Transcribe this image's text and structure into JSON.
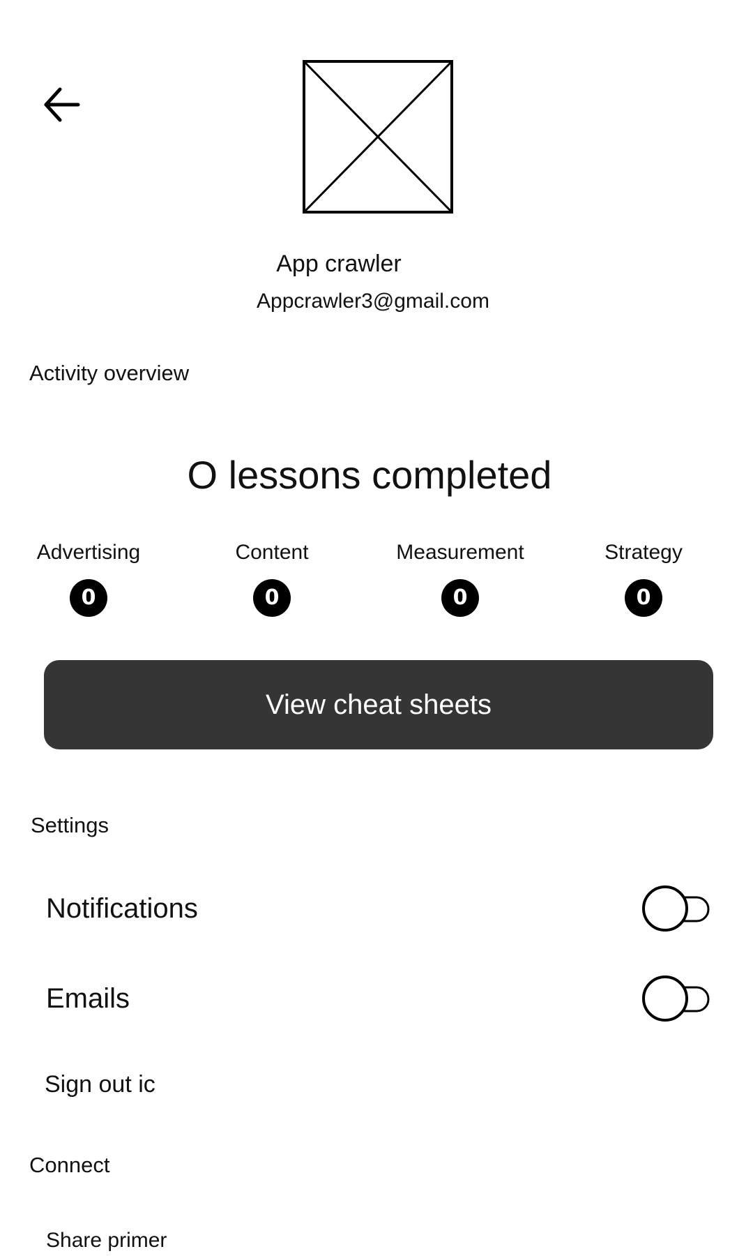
{
  "header": {
    "back_icon": "arrow-left-icon",
    "avatar_icon": "image-placeholder-icon"
  },
  "profile": {
    "name": "App crawler",
    "email": "Appcrawler3@gmail.com"
  },
  "activity": {
    "title": "Activity overview",
    "lessons_completed": "O lessons completed",
    "categories": [
      {
        "label": "Advertising",
        "count": "0"
      },
      {
        "label": "Content",
        "count": "0"
      },
      {
        "label": "Measurement",
        "count": "0"
      },
      {
        "label": "Strategy",
        "count": "0"
      }
    ],
    "cta_label": "View cheat sheets"
  },
  "settings": {
    "title": "Settings",
    "notifications_label": "Notifications",
    "notifications_on": false,
    "emails_label": "Emails",
    "emails_on": false,
    "sign_out_label": "Sign out ic"
  },
  "connect": {
    "title": "Connect",
    "share_label": "Share primer"
  }
}
